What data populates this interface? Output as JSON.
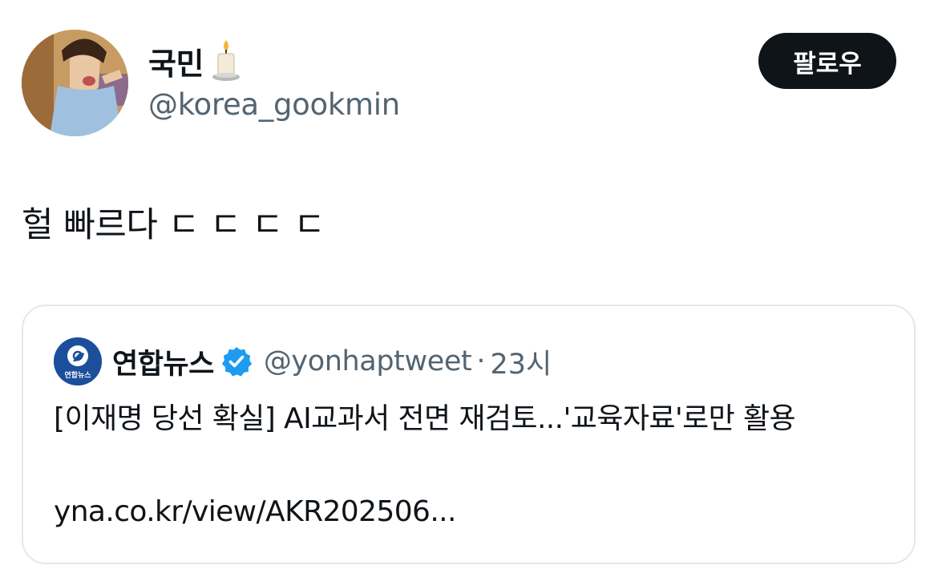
{
  "author": {
    "display_name": "국민",
    "handle": "@korea_gookmin",
    "avatar_icon": "cartoon-character-avatar",
    "name_emoji_icon": "candle-icon"
  },
  "follow_button": {
    "label": "팔로우"
  },
  "tweet": {
    "text": "헐 빠르다 ㄷ ㄷ ㄷ ㄷ"
  },
  "quoted_tweet": {
    "display_name": "연합뉴스",
    "avatar_text": "연합뉴스",
    "verified_icon": "verified-badge-icon",
    "verified_color": "#1d9bf0",
    "handle": "@yonhaptweet",
    "separator": "·",
    "time": "23시",
    "text": "[이재명 당선 확실] AI교과서 전면 재검토...'교육자료'로만 활용",
    "link": "yna.co.kr/view/AKR202506..."
  },
  "colors": {
    "text_primary": "#0f1419",
    "text_secondary": "#536471",
    "button_bg": "#0f1419",
    "card_border": "#e4e8eb",
    "yonhap_blue": "#1b4f9c"
  }
}
